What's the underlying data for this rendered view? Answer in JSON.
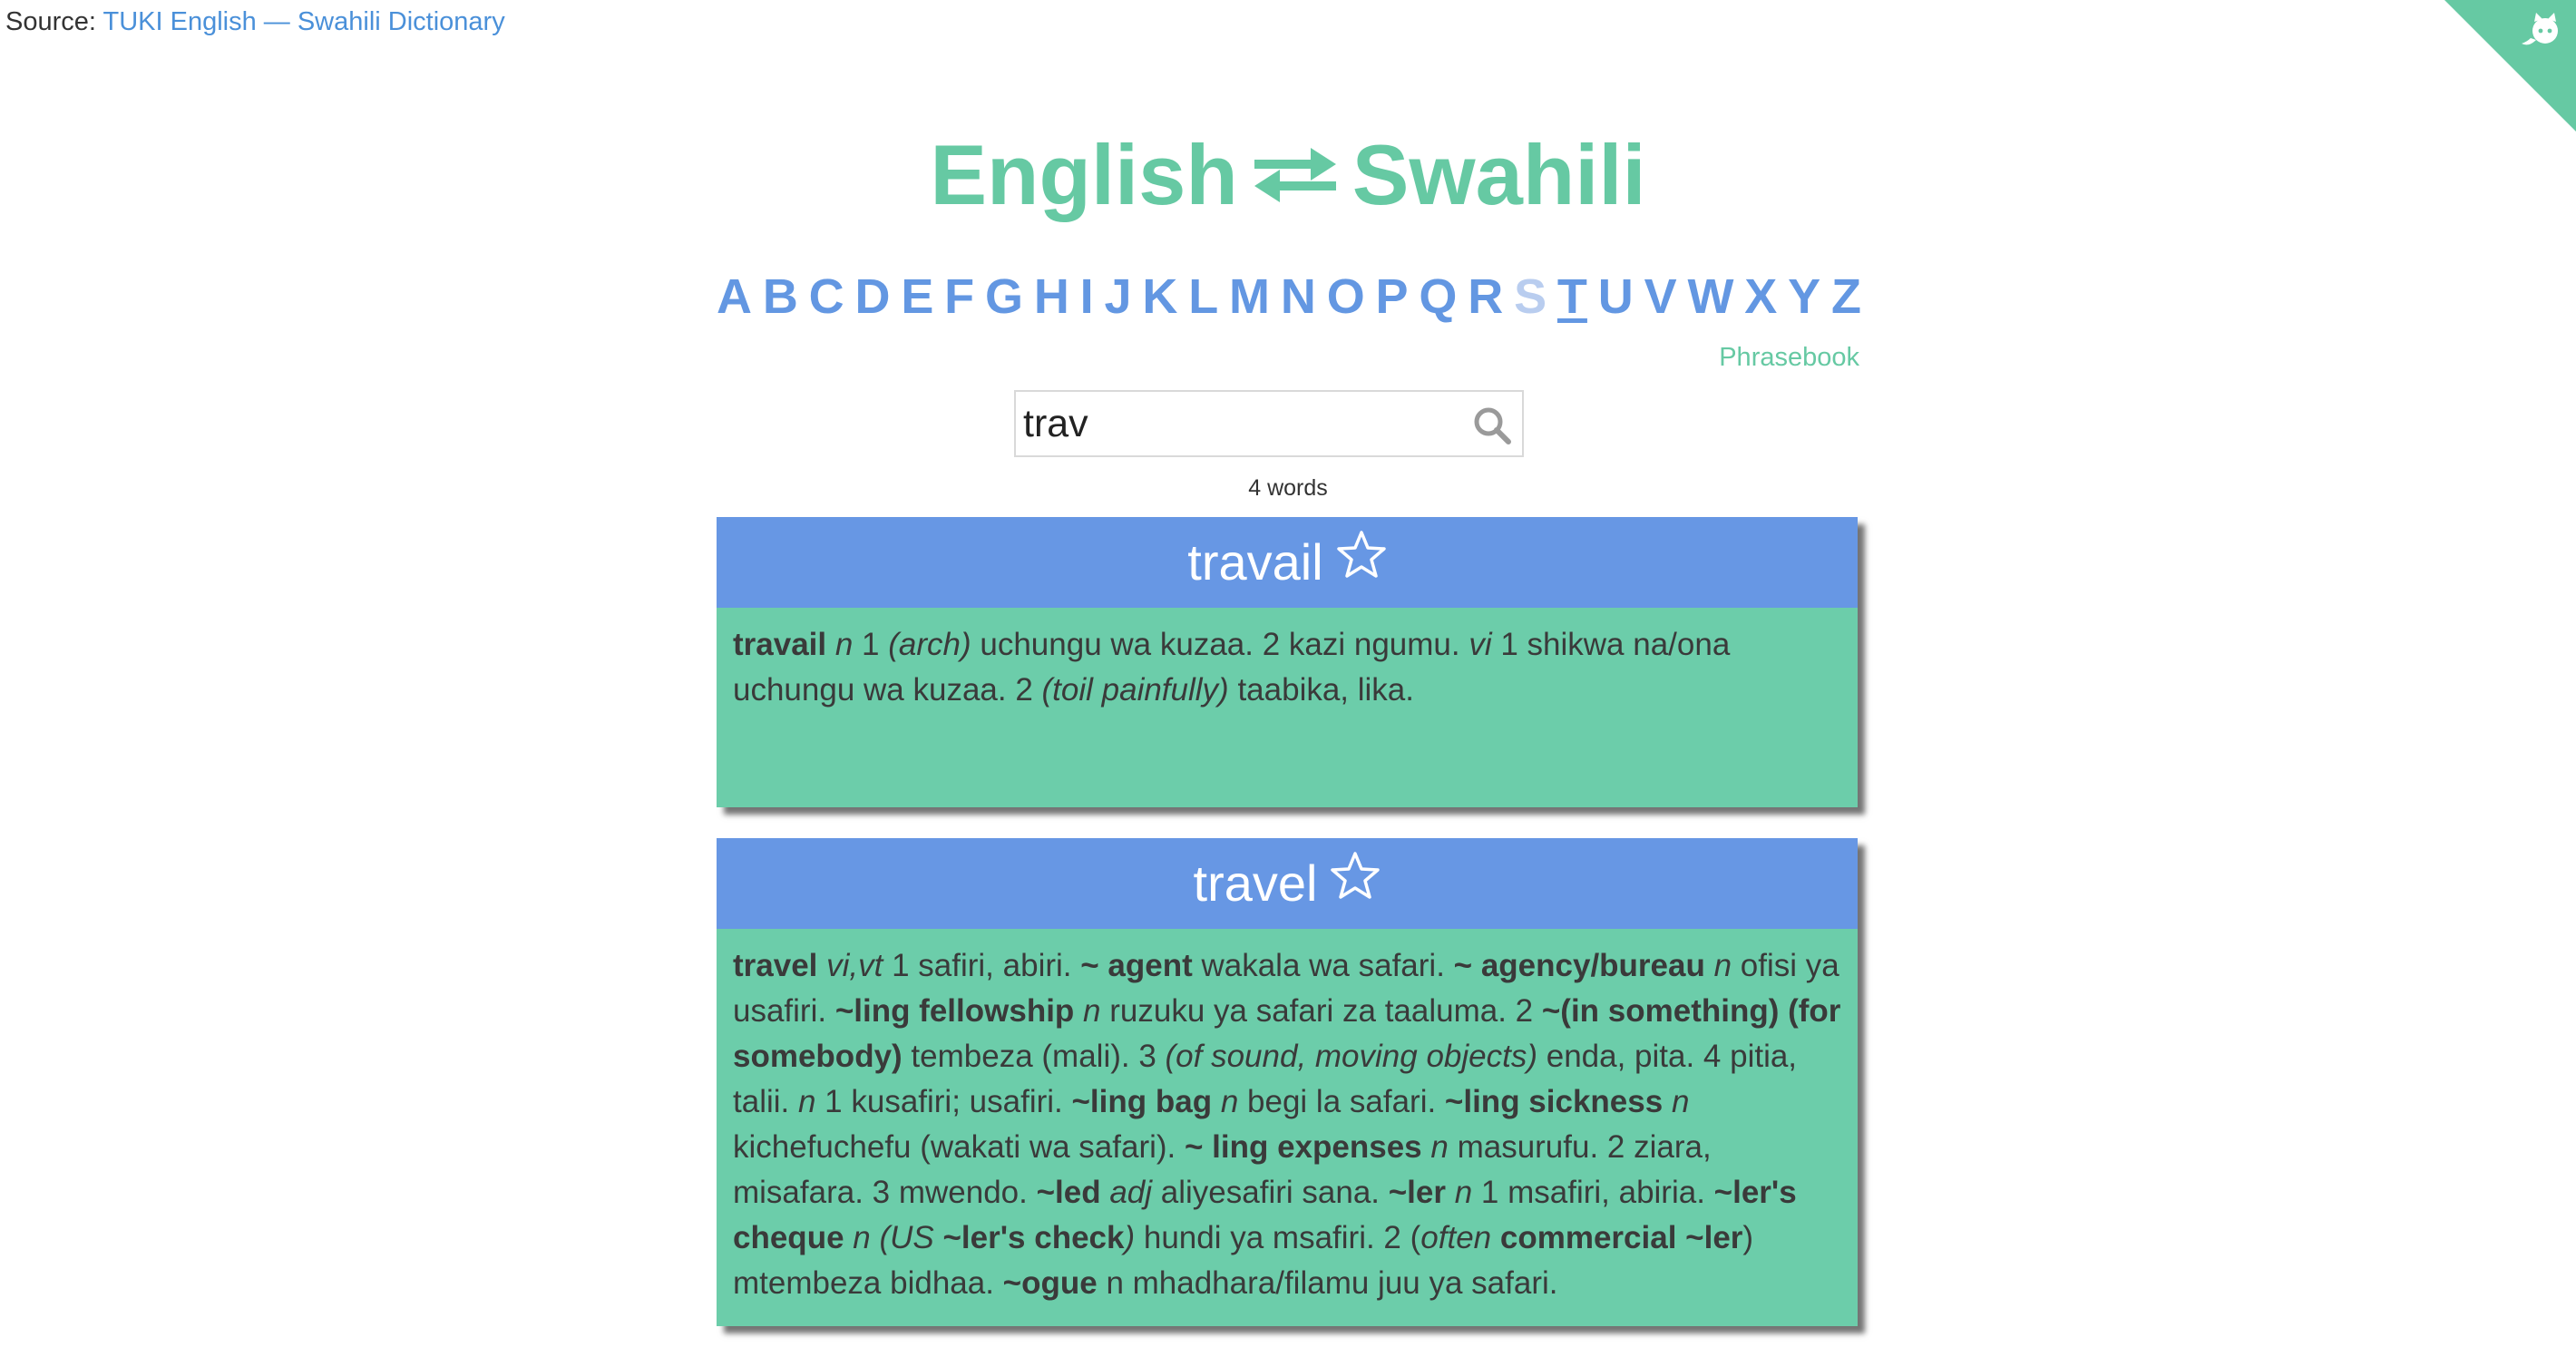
{
  "source": {
    "prefix": "Source:",
    "link_text": "TUKI English — Swahili Dictionary"
  },
  "title": {
    "left": "English",
    "right": "Swahili"
  },
  "alphabet": [
    "A",
    "B",
    "C",
    "D",
    "E",
    "F",
    "G",
    "H",
    "I",
    "J",
    "K",
    "L",
    "M",
    "N",
    "O",
    "P",
    "Q",
    "R",
    "S",
    "T",
    "U",
    "V",
    "W",
    "X",
    "Y",
    "Z"
  ],
  "alphabet_state": {
    "active": "T",
    "dimmed": "S"
  },
  "phrasebook_label": "Phrasebook",
  "search": {
    "value": "trav"
  },
  "word_count": "4 words",
  "colors": {
    "green": "#66c9a3",
    "blue": "#6397e2",
    "card_green": "#6ccdaa",
    "card_blue": "#6797e4"
  },
  "icons": {
    "search": "search-icon",
    "favorite": "star-outline-icon",
    "swap": "swap-arrows-icon",
    "github": "github-octocat-icon"
  },
  "entries": [
    {
      "word": "travail",
      "definition": [
        {
          "t": "travail",
          "s": "b"
        },
        {
          "t": " "
        },
        {
          "t": "n",
          "s": "i"
        },
        {
          "t": " 1 "
        },
        {
          "t": "(arch)",
          "s": "i"
        },
        {
          "t": " uchungu wa kuzaa. 2 kazi ngumu. "
        },
        {
          "t": "vi",
          "s": "i"
        },
        {
          "t": " 1 shikwa na/ona uchungu wa kuzaa. 2 "
        },
        {
          "t": "(toil painfully)",
          "s": "i"
        },
        {
          "t": " taabika, lika."
        }
      ]
    },
    {
      "word": "travel",
      "definition": [
        {
          "t": "travel",
          "s": "b"
        },
        {
          "t": " "
        },
        {
          "t": "vi,vt",
          "s": "i"
        },
        {
          "t": " 1 safiri, abiri. "
        },
        {
          "t": "~ agent",
          "s": "b"
        },
        {
          "t": " wakala wa safari. "
        },
        {
          "t": "~ agency/bureau",
          "s": "b"
        },
        {
          "t": " "
        },
        {
          "t": "n",
          "s": "i"
        },
        {
          "t": " ofisi ya usafiri. "
        },
        {
          "t": "~ling fellowship",
          "s": "b"
        },
        {
          "t": " "
        },
        {
          "t": "n",
          "s": "i"
        },
        {
          "t": " ruzuku ya safari za taaluma. 2 "
        },
        {
          "t": "~(in something) (for somebody)",
          "s": "b"
        },
        {
          "t": " tembeza (mali). 3 "
        },
        {
          "t": "(of sound, moving objects)",
          "s": "i"
        },
        {
          "t": " enda, pita. 4 pitia, talii. "
        },
        {
          "t": "n",
          "s": "i"
        },
        {
          "t": " 1 kusafiri; usafiri. "
        },
        {
          "t": "~ling bag",
          "s": "b"
        },
        {
          "t": " "
        },
        {
          "t": "n",
          "s": "i"
        },
        {
          "t": " begi la safari. "
        },
        {
          "t": "~ling sickness",
          "s": "b"
        },
        {
          "t": " "
        },
        {
          "t": "n",
          "s": "i"
        },
        {
          "t": " kichefuchefu (wakati wa safari). "
        },
        {
          "t": "~ ling expenses",
          "s": "b"
        },
        {
          "t": " "
        },
        {
          "t": "n",
          "s": "i"
        },
        {
          "t": " masurufu. 2 ziara, misafara. 3 mwendo. "
        },
        {
          "t": "~led",
          "s": "b"
        },
        {
          "t": " "
        },
        {
          "t": "adj",
          "s": "i"
        },
        {
          "t": " aliyesafiri sana. "
        },
        {
          "t": "~ler",
          "s": "b"
        },
        {
          "t": " "
        },
        {
          "t": "n",
          "s": "i"
        },
        {
          "t": " 1 msafiri, abiria. "
        },
        {
          "t": "~ler's cheque",
          "s": "b"
        },
        {
          "t": " "
        },
        {
          "t": "n",
          "s": "i"
        },
        {
          "t": " "
        },
        {
          "t": "(US ",
          "s": "i"
        },
        {
          "t": "~ler's check",
          "s": "b"
        },
        {
          "t": ")",
          "s": "i"
        },
        {
          "t": " hundi ya msafiri. 2 ("
        },
        {
          "t": "often",
          "s": "i"
        },
        {
          "t": " "
        },
        {
          "t": "commercial ~ler",
          "s": "b"
        },
        {
          "t": ") mtembeza bidhaa. "
        },
        {
          "t": "~ogue",
          "s": "b"
        },
        {
          "t": " n mhadhara/filamu juu ya safari."
        }
      ]
    }
  ]
}
